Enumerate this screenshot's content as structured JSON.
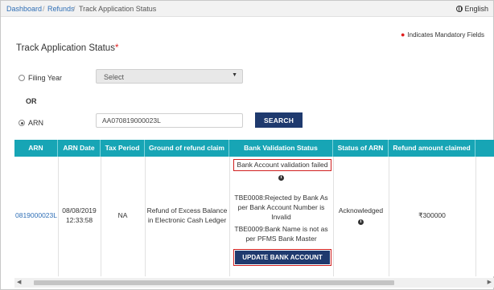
{
  "breadcrumb": {
    "items": [
      "Dashboard",
      "Refunds"
    ],
    "separator": "/",
    "current": "Track Application Status"
  },
  "language": "English",
  "mandatory_note": "Indicates Mandatory Fields",
  "page_title": "Track Application Status",
  "required_marker": "*",
  "form": {
    "filing_year_label": "Filing Year",
    "filing_year_value": "Select",
    "or_label": "OR",
    "arn_label": "ARN",
    "arn_value": "AA070819000023L",
    "search_label": "SEARCH"
  },
  "table": {
    "headers": [
      "ARN",
      "ARN Date",
      "Tax Period",
      "Ground of refund claim",
      "Bank Validation Status",
      "Status of ARN",
      "Refund amount claimed"
    ],
    "row": {
      "arn": "0819000023L",
      "arn_date_line1": "08/08/2019",
      "arn_date_line2": "12:33:58",
      "tax_period": "NA",
      "ground_line1": "Refund of Excess Balance",
      "ground_line2": "in Electronic Cash Ledger",
      "bank_status_failed": "Bank Account validation failed",
      "tbe0008_line1": "TBE0008:Rejected by Bank As",
      "tbe0008_line2": "per Bank Account Number is",
      "tbe0008_line3": "Invalid",
      "tbe0009_line1": "TBE0009:Bank Name is not as",
      "tbe0009_line2": "per PFMS Bank Master",
      "update_button": "UPDATE BANK ACCOUNT",
      "status_of_arn": "Acknowledged",
      "refund_amount": "₹300000"
    }
  },
  "icons": {
    "info": "info-icon",
    "globe": "globe-icon"
  },
  "colors": {
    "header_teal": "#17a5b5",
    "button_navy": "#1f3a6e",
    "highlight_red": "#d02020",
    "link_blue": "#2f6fb6"
  }
}
